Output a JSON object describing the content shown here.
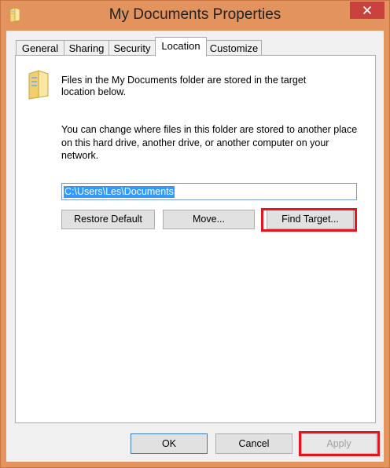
{
  "window": {
    "title": "My Documents Properties",
    "icon": "folder-icon",
    "close_icon": "close-icon"
  },
  "tabs": [
    {
      "label": "General",
      "active": false
    },
    {
      "label": "Sharing",
      "active": false
    },
    {
      "label": "Security",
      "active": false
    },
    {
      "label": "Location",
      "active": true
    },
    {
      "label": "Customize",
      "active": false
    }
  ],
  "location": {
    "description": "Files in the My Documents folder are stored in the target location below.",
    "explanation": "You can change where files in this folder are stored to another place on this hard drive, another drive, or another computer on your network.",
    "path_value": "C:\\Users\\Les\\Documents",
    "restore_default_label": "Restore Default",
    "move_label": "Move...",
    "find_target_label": "Find Target..."
  },
  "footer": {
    "ok_label": "OK",
    "cancel_label": "Cancel",
    "apply_label": "Apply"
  },
  "colors": {
    "title_bar": "#e3935d",
    "highlight": "#e8141d",
    "selection": "#3399ff",
    "close_button": "#c8413c"
  }
}
